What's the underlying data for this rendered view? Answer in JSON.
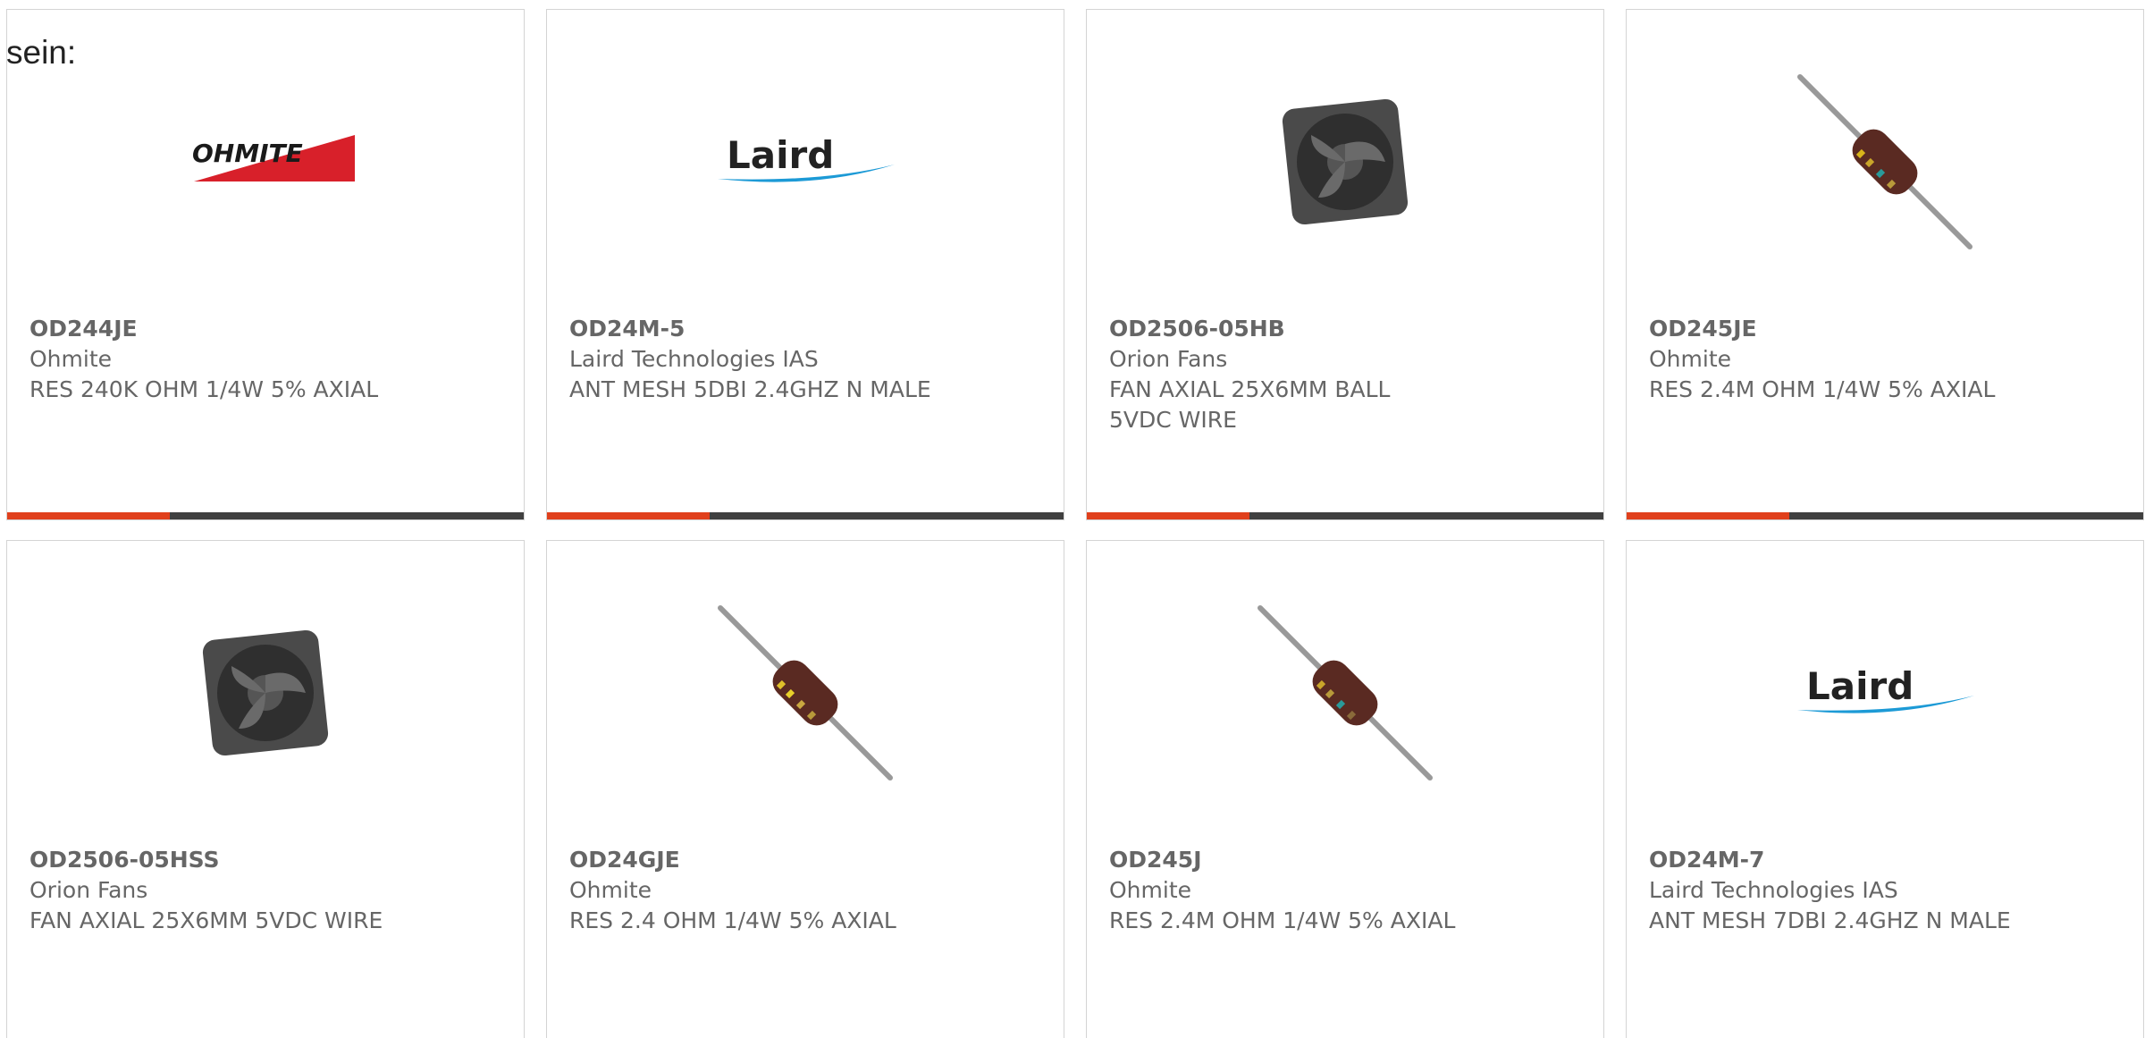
{
  "overlay_text": "sein:",
  "accent_color": "#e0401c",
  "bar_color": "#404040",
  "products": [
    {
      "part": "OD244JE",
      "maker": "Ohmite",
      "desc": "RES 240K OHM 1/4W 5% AXIAL",
      "image": "ohmite-logo"
    },
    {
      "part": "OD24M-5",
      "maker": "Laird Technologies IAS",
      "desc": "ANT MESH 5DBI 2.4GHZ N MALE",
      "image": "laird-logo"
    },
    {
      "part": "OD2506-05HB",
      "maker": "Orion Fans",
      "desc": "FAN AXIAL 25X6MM BALL 5VDC WIRE",
      "image": "fan-photo"
    },
    {
      "part": "OD245JE",
      "maker": "Ohmite",
      "desc": "RES 2.4M OHM 1/4W 5% AXIAL",
      "image": "resistor-photo-green"
    },
    {
      "part": "OD2506-05HSS",
      "maker": "Orion Fans",
      "desc": "FAN AXIAL 25X6MM 5VDC WIRE",
      "image": "fan-photo"
    },
    {
      "part": "OD24GJE",
      "maker": "Ohmite",
      "desc": "RES 2.4 OHM 1/4W 5% AXIAL",
      "image": "resistor-photo-gold"
    },
    {
      "part": "OD245J",
      "maker": "Ohmite",
      "desc": "RES 2.4M OHM 1/4W 5% AXIAL",
      "image": "resistor-photo-green"
    },
    {
      "part": "OD24M-7",
      "maker": "Laird Technologies IAS",
      "desc": "ANT MESH 7DBI 2.4GHZ N MALE",
      "image": "laird-logo"
    }
  ]
}
